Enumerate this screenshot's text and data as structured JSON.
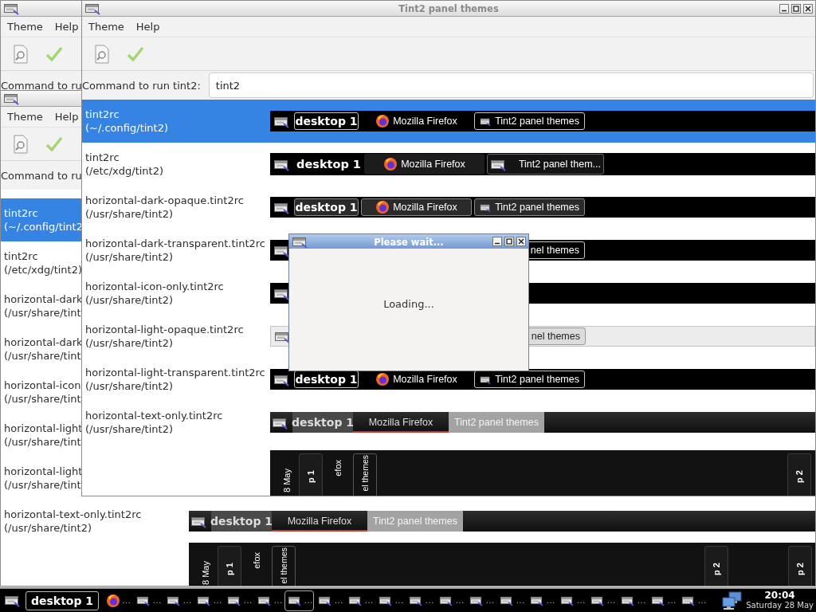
{
  "windows": [
    {
      "kind": "back-top",
      "menu": [
        "Theme",
        "Help"
      ],
      "command_label": "Command to ru"
    },
    {
      "kind": "back",
      "menu": [
        "Theme",
        "Help"
      ],
      "command_label": "Command to ru",
      "themes": [
        {
          "name": "tint2rc",
          "path": "(~/.config/tint2",
          "selected": true
        },
        {
          "name": "tint2rc",
          "path": "(/etc/xdg/tint2)",
          "selected": false
        },
        {
          "name": "horizontal-dark",
          "path": "(/usr/share/tint",
          "selected": false
        },
        {
          "name": "horizontal-dark",
          "path": "(/usr/share/tint",
          "selected": false
        },
        {
          "name": "horizontal-icon",
          "path": "(/usr/share/tint",
          "selected": false
        },
        {
          "name": "horizontal-light",
          "path": "(/usr/share/tint",
          "selected": false
        },
        {
          "name": "horizontal-light",
          "path": "(/usr/share/tint",
          "selected": false
        },
        {
          "name": "horizontal-text-only.tint2rc",
          "path": "(/usr/share/tint2)",
          "selected": false,
          "preview": {
            "kind": "text-only",
            "tasks": [
              {
                "kind": "desktop",
                "label": "desktop 1"
              },
              {
                "kind": "app",
                "label": "Mozilla Firefox"
              },
              {
                "kind": "window",
                "label": "Tint2 panel themes"
              }
            ]
          }
        },
        {
          "selected": false,
          "preview": {
            "kind": "vertical",
            "tasks": [
              {
                "kind": "clock",
                "label": "8 May"
              },
              {
                "kind": "desktop",
                "label": "p 1"
              },
              {
                "kind": "app",
                "label": "efox"
              },
              {
                "kind": "window",
                "label": "el themes"
              },
              {
                "kind": "desktop-end",
                "label": "p 2"
              },
              {
                "kind": "desktop-end",
                "label": "p 2"
              }
            ]
          }
        }
      ]
    },
    {
      "kind": "main",
      "title": "Tint2 panel themes",
      "menu": [
        "Theme",
        "Help"
      ],
      "command_label": "Command to run tint2:",
      "command_value": "tint2",
      "themes": [
        {
          "name": "tint2rc",
          "path": "(~/.config/tint2)",
          "selected": true,
          "preview": {
            "kind": "dark-boxed",
            "tasks": [
              {
                "kind": "desktop",
                "label": "desktop 1"
              },
              {
                "kind": "app",
                "label": "Mozilla Firefox"
              },
              {
                "kind": "window",
                "label": "Tint2 panel themes"
              }
            ]
          }
        },
        {
          "name": "tint2rc",
          "path": "(/etc/xdg/tint2)",
          "selected": false,
          "preview": {
            "kind": "dark-mixed",
            "tasks": [
              {
                "kind": "desktop",
                "label": "desktop 1"
              },
              {
                "kind": "app",
                "label": "Mozilla Firefox"
              },
              {
                "kind": "window",
                "label": "Tint2 panel them..."
              }
            ]
          }
        },
        {
          "name": "horizontal-dark-opaque.tint2rc",
          "path": "(/usr/share/tint2)",
          "selected": false,
          "preview": {
            "kind": "dark-opaque",
            "tasks": [
              {
                "kind": "desktop",
                "label": "desktop 1"
              },
              {
                "kind": "app",
                "label": "Mozilla Firefox"
              },
              {
                "kind": "window",
                "label": "Tint2 panel themes"
              }
            ]
          }
        },
        {
          "name": "horizontal-dark-transparent.tint2rc",
          "path": "(/usr/share/tint2)",
          "selected": false,
          "preview": {
            "kind": "dark-boxed",
            "tasks": [
              {
                "kind": "window-tail",
                "label": "nel themes"
              }
            ]
          }
        },
        {
          "name": "horizontal-icon-only.tint2rc",
          "path": "(/usr/share/tint2)",
          "selected": false,
          "preview": {
            "kind": "dark-boxed"
          }
        },
        {
          "name": "horizontal-light-opaque.tint2rc",
          "path": "(/usr/share/tint2)",
          "selected": false,
          "preview": {
            "kind": "light-opaque",
            "tasks": [
              {
                "kind": "window-tail",
                "label": "nel themes"
              }
            ]
          }
        },
        {
          "name": "horizontal-light-transparent.tint2rc",
          "path": "(/usr/share/tint2)",
          "selected": false,
          "preview": {
            "kind": "dark-boxed",
            "tasks": [
              {
                "kind": "desktop",
                "label": "desktop 1"
              },
              {
                "kind": "app",
                "label": "Mozilla Firefox"
              },
              {
                "kind": "window",
                "label": "Tint2 panel themes"
              }
            ]
          }
        },
        {
          "name": "horizontal-text-only.tint2rc",
          "path": "(/usr/share/tint2)",
          "selected": false,
          "preview": {
            "kind": "text-only",
            "tasks": [
              {
                "kind": "desktop",
                "label": "desktop 1"
              },
              {
                "kind": "app",
                "label": "Mozilla Firefox"
              },
              {
                "kind": "window",
                "label": "Tint2 panel themes"
              }
            ]
          }
        },
        {
          "selected": false,
          "preview": {
            "kind": "vertical",
            "tasks": [
              {
                "kind": "clock",
                "label": "8 May"
              },
              {
                "kind": "desktop",
                "label": "p 1"
              },
              {
                "kind": "app",
                "label": "efox"
              },
              {
                "kind": "window",
                "label": "el themes"
              },
              {
                "kind": "desktop-end",
                "label": "p 2"
              }
            ]
          }
        }
      ]
    }
  ],
  "dialog": {
    "title": "Please wait...",
    "message": "Loading..."
  },
  "taskbar": {
    "desktop": "desktop 1",
    "tasks": [
      {
        "kind": "app",
        "label": "…",
        "selected": false
      },
      {
        "kind": "window",
        "label": "…",
        "selected": false
      },
      {
        "kind": "window",
        "label": "…",
        "selected": false
      },
      {
        "kind": "window",
        "label": "…",
        "selected": false
      },
      {
        "kind": "window",
        "label": "…",
        "selected": false
      },
      {
        "kind": "window",
        "label": "…",
        "selected": false
      },
      {
        "kind": "window",
        "label": "…",
        "selected": true
      },
      {
        "kind": "window",
        "label": "…",
        "selected": false
      },
      {
        "kind": "window",
        "label": "…",
        "selected": false
      },
      {
        "kind": "window",
        "label": "…",
        "selected": false
      },
      {
        "kind": "window",
        "label": "…",
        "selected": false
      },
      {
        "kind": "window",
        "label": "…",
        "selected": false
      },
      {
        "kind": "window",
        "label": "…",
        "selected": false
      },
      {
        "kind": "window",
        "label": "…",
        "selected": false
      },
      {
        "kind": "window",
        "label": "…",
        "selected": false
      },
      {
        "kind": "window",
        "label": "…",
        "selected": false
      },
      {
        "kind": "window",
        "label": "…",
        "selected": false
      },
      {
        "kind": "window",
        "label": "…",
        "selected": false
      },
      {
        "kind": "window",
        "label": "…",
        "selected": false
      },
      {
        "kind": "window",
        "label": "…",
        "selected": false
      }
    ],
    "clock": {
      "time": "20:04",
      "date": "Saturday 28 May"
    }
  }
}
